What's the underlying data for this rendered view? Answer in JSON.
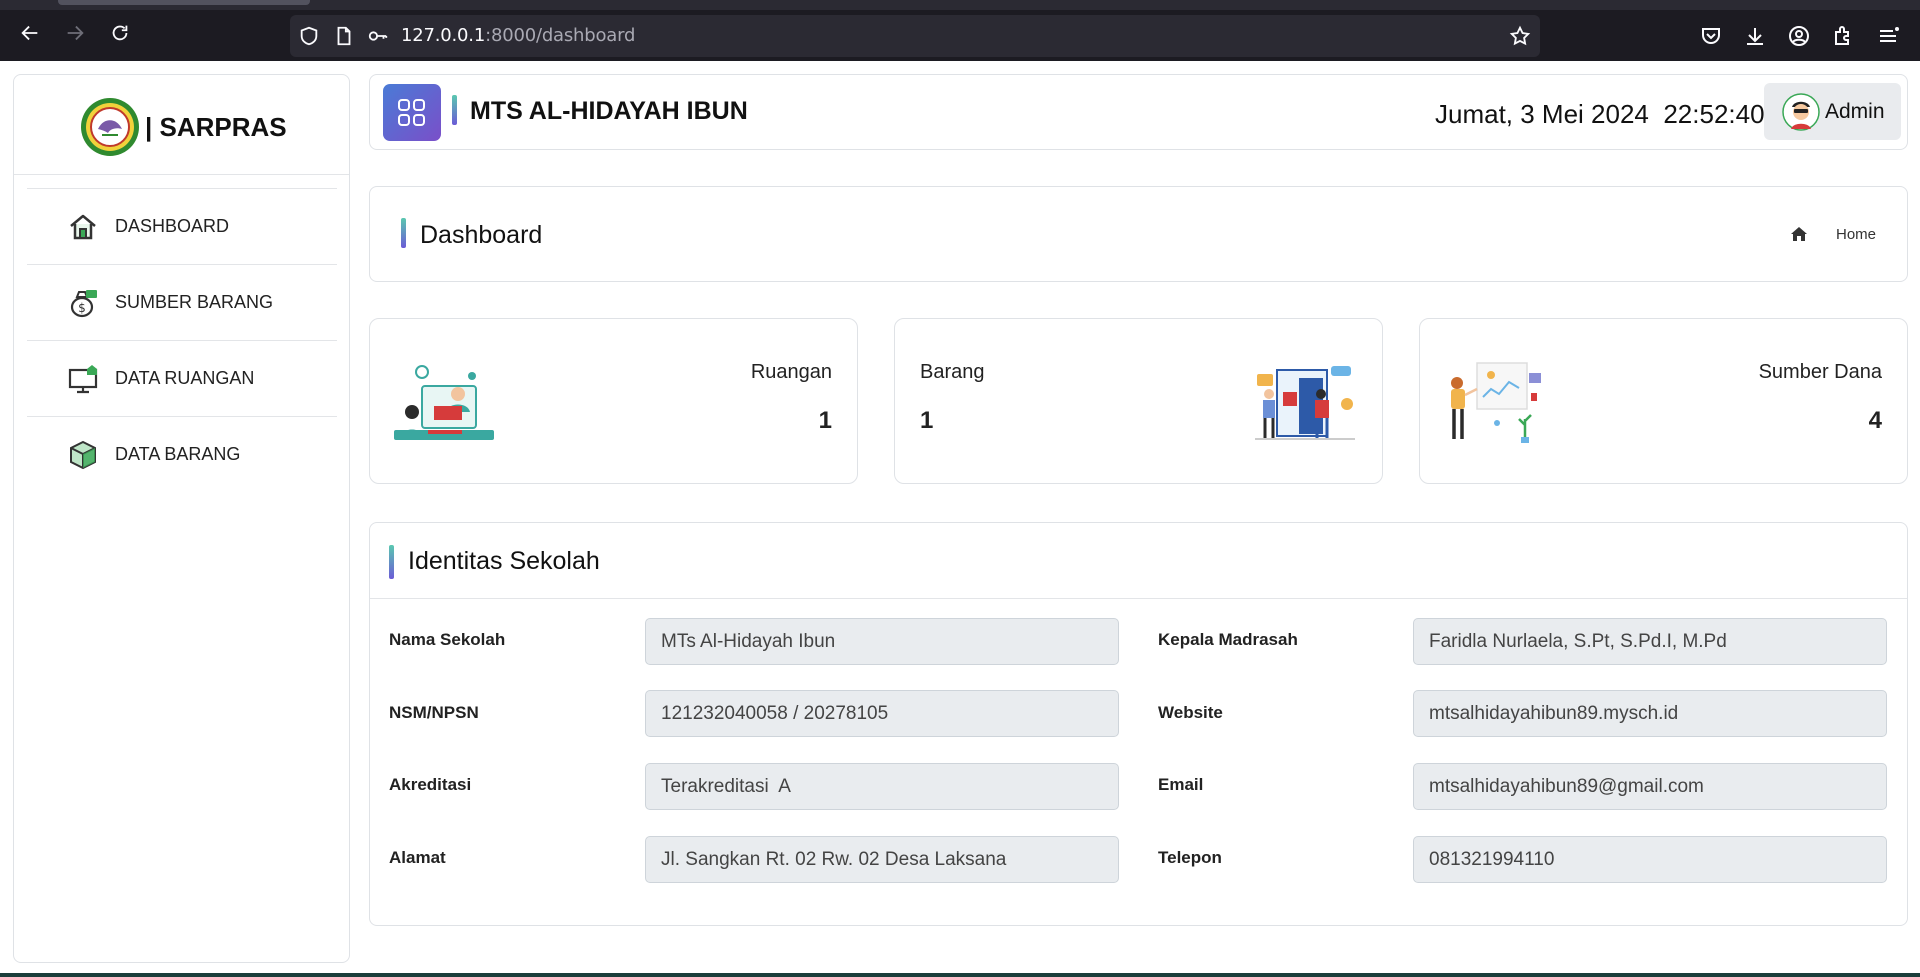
{
  "browser": {
    "url_host": "127.0.0.1",
    "url_path": ":8000/dashboard"
  },
  "sidebar": {
    "brand": "| SARPRAS",
    "items": [
      {
        "label": "DASHBOARD",
        "icon": "home-icon"
      },
      {
        "label": "SUMBER BARANG",
        "icon": "money-bag-icon"
      },
      {
        "label": "DATA RUANGAN",
        "icon": "monitor-home-icon"
      },
      {
        "label": "DATA BARANG",
        "icon": "box-icon"
      }
    ]
  },
  "header": {
    "school_name": "MTS AL-HIDAYAH IBUN",
    "datetime": "Jumat, 3 Mei 2024  22:52:40",
    "user": "Admin"
  },
  "page": {
    "title": "Dashboard",
    "breadcrumb_home": "Home"
  },
  "stats": [
    {
      "label": "Ruangan",
      "value": "1"
    },
    {
      "label": "Barang",
      "value": "1"
    },
    {
      "label": "Sumber Dana",
      "value": "4"
    }
  ],
  "identity": {
    "title": "Identitas Sekolah",
    "fields": [
      {
        "label": "Nama Sekolah",
        "value": "MTs Al-Hidayah Ibun"
      },
      {
        "label": "NSM/NPSN",
        "value": "121232040058 / 20278105"
      },
      {
        "label": "Akreditasi",
        "value": "Terakreditasi  A"
      },
      {
        "label": "Alamat",
        "value": "Jl. Sangkan Rt. 02 Rw. 02 Desa Laksana"
      },
      {
        "label": "Kepala Madrasah",
        "value": "Faridla Nurlaela, S.Pt, S.Pd.I, M.Pd"
      },
      {
        "label": "Website",
        "value": "mtsalhidayahibun89.mysch.id"
      },
      {
        "label": "Email",
        "value": "mtsalhidayahibun89@gmail.com"
      },
      {
        "label": "Telepon",
        "value": "081321994110"
      }
    ]
  },
  "colors": {
    "accent_gradient_start": "#5ac8b0",
    "accent_gradient_end": "#6b5bd6",
    "apps_button_start": "#4a7bd6",
    "apps_button_end": "#7a4fc9",
    "input_bg": "#e9ecef"
  }
}
